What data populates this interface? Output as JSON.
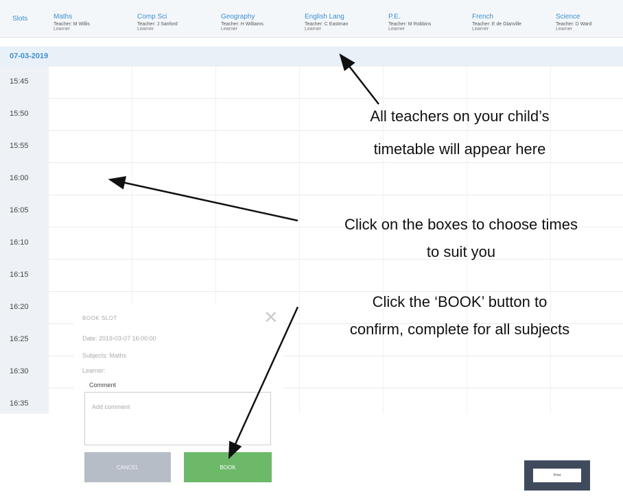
{
  "header": {
    "slots_label": "Slots",
    "columns": [
      {
        "subject": "Maths",
        "teacher": "Teacher: M Willis",
        "learner": "Learner"
      },
      {
        "subject": "Comp Sci",
        "teacher": "Teacher: J Sanford",
        "learner": "Learner"
      },
      {
        "subject": "Geography",
        "teacher": "Teacher: H Williams",
        "learner": "Learner"
      },
      {
        "subject": "English Lang",
        "teacher": "Teacher: C Eastman",
        "learner": "Learner"
      },
      {
        "subject": "P.E.",
        "teacher": "Teacher: M Robbins",
        "learner": "Learner"
      },
      {
        "subject": "French",
        "teacher": "Teacher: E de Glanville",
        "learner": "Learner"
      },
      {
        "subject": "Science",
        "teacher": "Teacher: D Ward",
        "learner": "Learner"
      }
    ]
  },
  "date": "07-03-2019",
  "times": [
    "15:45",
    "15:50",
    "15:55",
    "16:00",
    "16:05",
    "16:10",
    "16:15",
    "16:20",
    "16:25",
    "16:30",
    "16:35"
  ],
  "annotations": {
    "teachers_line1": "All teachers on your child’s",
    "teachers_line2": "timetable will appear here",
    "boxes_line1": "Click on the boxes to choose times",
    "boxes_line2": "to suit you",
    "book_line1": "Click the ‘BOOK’ button to",
    "book_line2": "confirm, complete for all subjects"
  },
  "modal": {
    "title": "BOOK SLOT",
    "close_icon": "close-icon",
    "date_line": "Date: 2019-03-07 16:00:00",
    "subjects_line": "Subjects: Maths",
    "learner_line": "Learner:",
    "comment_label": "Comment",
    "comment_placeholder": "Add comment",
    "cancel_label": "CANCEL",
    "book_label": "BOOK"
  },
  "print_button": {
    "label": "Print"
  },
  "colors": {
    "accent": "#3b8ed0",
    "book_button": "#6db96a",
    "cancel_button": "#b6bdc6",
    "print_button": "#3f4a5c"
  }
}
